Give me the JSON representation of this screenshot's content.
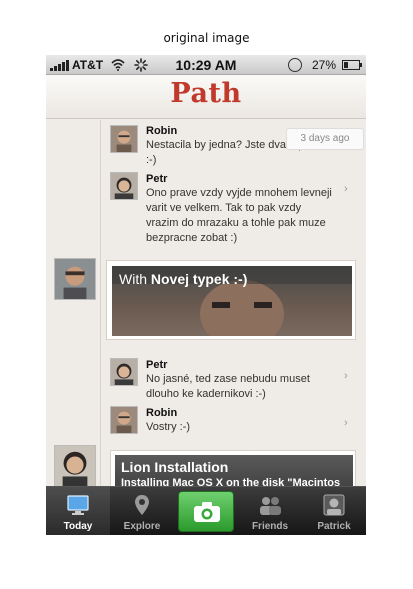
{
  "caption": "original image",
  "status_bar": {
    "carrier": "AT&T",
    "time": "10:29 AM",
    "battery_percent": "27%",
    "battery_level": 0.27,
    "icons": [
      "signal-bars-icon",
      "wifi-icon",
      "activity-spinner-icon",
      "rotation-lock-icon",
      "battery-icon"
    ]
  },
  "header": {
    "logo": "Path",
    "logo_color": "#c0392b"
  },
  "feed": {
    "items": [
      {
        "type": "comment",
        "author": "Robin",
        "text": "Nestacila by jedna? Jste dva u par ne :-)",
        "time": "3 days ago"
      },
      {
        "type": "comment",
        "author": "Petr",
        "text": "Ono prave vzdy vyjde mnohem levneji varit ve velkem. Tak to pak vzdy vrazim do mrazaku a tohle pak muze bezpracne zobat :)"
      },
      {
        "type": "photo",
        "title_prefix": "With ",
        "title_bold": "Novej typek :-)"
      },
      {
        "type": "comment",
        "author": "Petr",
        "text": "No jasné, ted zase nebudu muset dlouho ke kadernikovi :-)"
      },
      {
        "type": "comment",
        "author": "Robin",
        "text": "Vostry :-)"
      },
      {
        "type": "music",
        "title": "Lion Installation",
        "subtitle": "Installing Mac OS X on the disk \"Macintos"
      }
    ]
  },
  "tabbar": {
    "tabs": [
      {
        "label": "Today",
        "icon": "monitor-icon",
        "active": true
      },
      {
        "label": "Explore",
        "icon": "map-pin-icon",
        "active": false
      },
      {
        "label": "",
        "icon": "camera-icon",
        "active": false
      },
      {
        "label": "Friends",
        "icon": "friends-icon",
        "active": false
      },
      {
        "label": "Patrick",
        "icon": "profile-icon",
        "active": false
      }
    ],
    "camera_color": "#3aa83a"
  }
}
